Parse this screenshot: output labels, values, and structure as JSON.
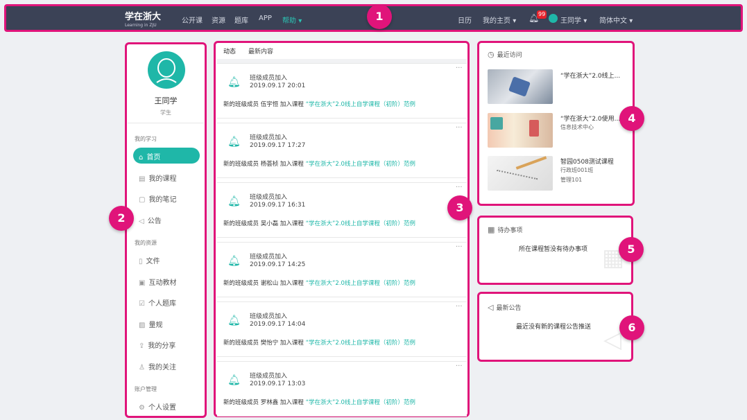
{
  "brand": {
    "logo": "学在浙大",
    "logo_sub": "Learning in ZJU"
  },
  "nav": {
    "left": [
      "公开课",
      "资源",
      "题库",
      "APP"
    ],
    "active": "帮助",
    "calendar": "日历",
    "home": "我的主页",
    "badge": "99",
    "user": "王同学",
    "lang": "简体中文"
  },
  "profile": {
    "name": "王同学",
    "role": "学生"
  },
  "sidebar": {
    "section1": "我的学习",
    "items1": [
      "首页",
      "我的课程",
      "我的笔记",
      "公告"
    ],
    "section2": "我的资源",
    "items2": [
      "文件",
      "互动教材",
      "个人题库",
      "量规",
      "我的分享",
      "我的关注"
    ],
    "section3": "账户管理",
    "items3": [
      "个人设置"
    ]
  },
  "feed": {
    "tabs": [
      "动态",
      "最新内容"
    ],
    "cards": [
      {
        "title": "班级成员加入",
        "time": "2019.09.17 20:01",
        "prefix": "新的班级成员 伍宇恒 加入课程",
        "course": "“学在浙大”2.0线上自学课程（初阶）范例"
      },
      {
        "title": "班级成员加入",
        "time": "2019.09.17 17:27",
        "prefix": "新的班级成员 杨荟桢 加入课程",
        "course": "“学在浙大”2.0线上自学课程（初阶）范例"
      },
      {
        "title": "班级成员加入",
        "time": "2019.09.17 16:31",
        "prefix": "新的班级成员 吴小磊 加入课程",
        "course": "“学在浙大”2.0线上自学课程（初阶）范例"
      },
      {
        "title": "班级成员加入",
        "time": "2019.09.17 14:25",
        "prefix": "新的班级成员 谢松山 加入课程",
        "course": "“学在浙大”2.0线上自学课程（初阶）范例"
      },
      {
        "title": "班级成员加入",
        "time": "2019.09.17 14:04",
        "prefix": "新的班级成员 樊怡宁 加入课程",
        "course": "“学在浙大”2.0线上自学课程（初阶）范例"
      },
      {
        "title": "班级成员加入",
        "time": "2019.09.17 13:03",
        "prefix": "新的班级成员 罗林鑫 加入课程",
        "course": "“学在浙大”2.0线上自学课程（初阶）范例"
      }
    ]
  },
  "recent": {
    "title": "最近访问",
    "items": [
      {
        "title": "“学在浙大”2.0线上...",
        "sub1": "",
        "sub2": ""
      },
      {
        "title": "“学在浙大”2.0使用...",
        "sub1": "信息技术中心",
        "sub2": ""
      },
      {
        "title": "智园0508测试课程",
        "sub1": "行政班001班",
        "sub2": "管理101"
      }
    ]
  },
  "todo": {
    "title": "待办事项",
    "message": "所在课程暂没有待办事项"
  },
  "notice": {
    "title": "最新公告",
    "message": "最近没有新的课程公告推送"
  },
  "callouts": [
    "1",
    "2",
    "3",
    "4",
    "5",
    "6"
  ],
  "colors": {
    "accent": "#1fb7a8",
    "highlight": "#e0147a",
    "navbar": "#3b4256"
  },
  "icons": [
    "bell-icon",
    "clock-icon",
    "calendar-icon",
    "megaphone-icon",
    "home-icon",
    "chevron-down-icon"
  ]
}
